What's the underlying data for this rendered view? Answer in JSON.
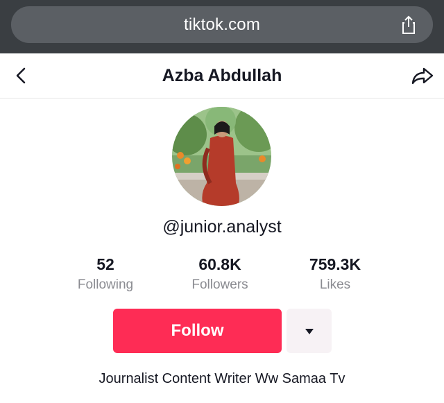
{
  "browser": {
    "url": "tiktok.com",
    "share_icon": "share-up-icon"
  },
  "header": {
    "title": "Azba Abdullah",
    "back_icon": "chevron-left-icon",
    "share_icon": "share-arrow-icon"
  },
  "profile": {
    "username": "@junior.analyst",
    "stats": [
      {
        "value": "52",
        "label": "Following"
      },
      {
        "value": "60.8K",
        "label": "Followers"
      },
      {
        "value": "759.3K",
        "label": "Likes"
      }
    ],
    "follow_label": "Follow",
    "bio": "Journalist Content Writer Ww Samaa Tv"
  },
  "colors": {
    "accent": "#fe2c55",
    "browser_bar": "#3a3e42",
    "text_muted": "#8a8b91"
  }
}
